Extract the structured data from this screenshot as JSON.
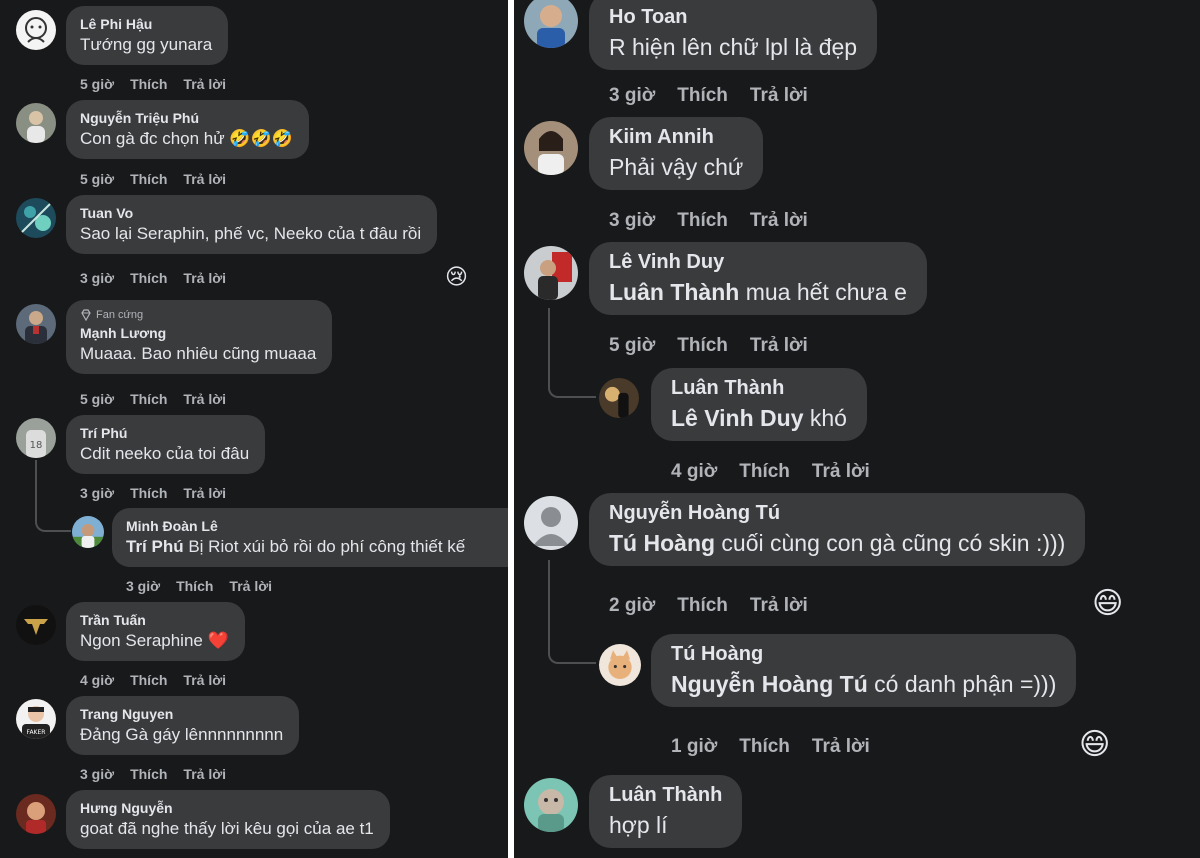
{
  "left": {
    "comments": [
      {
        "name": "Lê Phi Hậu",
        "text": "Tướng gg yunara",
        "time": "5 giờ",
        "like": "Thích",
        "reply": "Trả lời"
      },
      {
        "name": "Nguyễn Triệu Phú",
        "text": "Con gà đc chọn hử 🤣🤣🤣",
        "time": "5 giờ",
        "like": "Thích",
        "reply": "Trả lời"
      },
      {
        "name": "Tuan Vo",
        "text": "Sao lại Seraphin, phế vc, Neeko của t đâu rồi",
        "time": "3 giờ",
        "like": "Thích",
        "reply": "Trả lời",
        "reaction": "😢"
      },
      {
        "badge": "Fan cứng",
        "name": "Mạnh Lương",
        "text": "Muaaa. Bao nhiêu cũng muaaa",
        "time": "5 giờ",
        "like": "Thích",
        "reply": "Trả lời"
      },
      {
        "name": "Trí Phú",
        "text": "Cdit neeko của toi đâu",
        "time": "3 giờ",
        "like": "Thích",
        "reply": "Trả lời"
      },
      {
        "name": "Minh Đoàn Lê",
        "mention": "Trí Phú",
        "text": " Bị Riot xúi bỏ rồi do phí công thiết kế",
        "time": "3 giờ",
        "like": "Thích",
        "reply": "Trả lời"
      },
      {
        "name": "Trần Tuấn",
        "text": "Ngon Seraphine ❤️",
        "time": "4 giờ",
        "like": "Thích",
        "reply": "Trả lời"
      },
      {
        "name": "Trang Nguyen",
        "text": "Đảng Gà gáy lênnnnnnnnn",
        "time": "3 giờ",
        "like": "Thích",
        "reply": "Trả lời",
        "avatar_label": "FAKER"
      },
      {
        "name": "Hưng Nguyễn",
        "text": "goat đã nghe thấy lời kêu gọi của ae t1"
      }
    ]
  },
  "right": {
    "comments": [
      {
        "name": "Ho Toan",
        "text": "R hiện lên chữ lpl là đẹp",
        "time": "3 giờ",
        "like": "Thích",
        "reply": "Trả lời"
      },
      {
        "name": "Kiim Annih",
        "text": "Phải vậy chứ",
        "time": "3 giờ",
        "like": "Thích",
        "reply": "Trả lời"
      },
      {
        "name": "Lê Vinh Duy",
        "mention": "Luân Thành",
        "text": " mua hết chưa e",
        "time": "5 giờ",
        "like": "Thích",
        "reply": "Trả lời"
      },
      {
        "name": "Luân Thành",
        "mention": "Lê Vinh Duy",
        "text": " khó",
        "time": "4 giờ",
        "like": "Thích",
        "reply": "Trả lời"
      },
      {
        "name": "Nguyễn Hoàng Tú",
        "mention": "Tú Hoàng",
        "text": " cuối cùng con gà cũng có skin :)))",
        "time": "2 giờ",
        "like": "Thích",
        "reply": "Trả lời",
        "reaction": "😄"
      },
      {
        "name": "Tú Hoàng",
        "mention": "Nguyễn Hoàng Tú",
        "text": " có danh phận =)))",
        "time": "1 giờ",
        "like": "Thích",
        "reply": "Trả lời",
        "reaction": "😄"
      },
      {
        "name": "Luân Thành",
        "text": "hợp lí"
      }
    ]
  },
  "colors": {
    "background": "#18191a",
    "bubble": "#3a3b3c",
    "text": "#e4e6eb",
    "meta": "#b0b3b8",
    "divider": "#ffffff"
  }
}
